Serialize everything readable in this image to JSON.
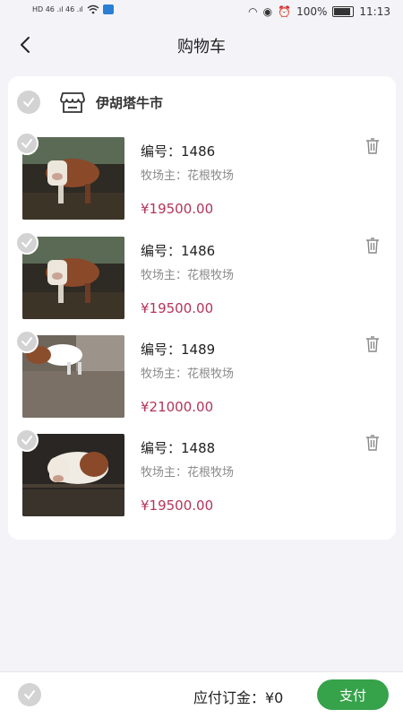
{
  "status_bar": {
    "left_indicators": "HD 46 .ıl 46 .ıl",
    "battery": "100%",
    "time": "11:13"
  },
  "header": {
    "title": "购物车"
  },
  "shop": {
    "name": "伊胡塔牛市"
  },
  "items": [
    {
      "code_label": "编号：1486",
      "owner_label": "牧场主：花根牧场",
      "price": "¥19500.00",
      "image": "cow-photo-brown-white"
    },
    {
      "code_label": "编号：1486",
      "owner_label": "牧场主：花根牧场",
      "price": "¥19500.00",
      "image": "cow-photo-brown-white"
    },
    {
      "code_label": "编号：1489",
      "owner_label": "牧场主：花根牧场",
      "price": "¥21000.00",
      "image": "cow-photo-pen"
    },
    {
      "code_label": "编号：1488",
      "owner_label": "牧场主：花根牧场",
      "price": "¥19500.00",
      "image": "cow-photo-closeup"
    }
  ],
  "footer": {
    "deposit_label": "应付订金：¥0",
    "pay_label": "支付"
  },
  "colors": {
    "price": "#b4345a",
    "pay_button": "#36a24a",
    "check_inactive": "#d3d3d3"
  }
}
